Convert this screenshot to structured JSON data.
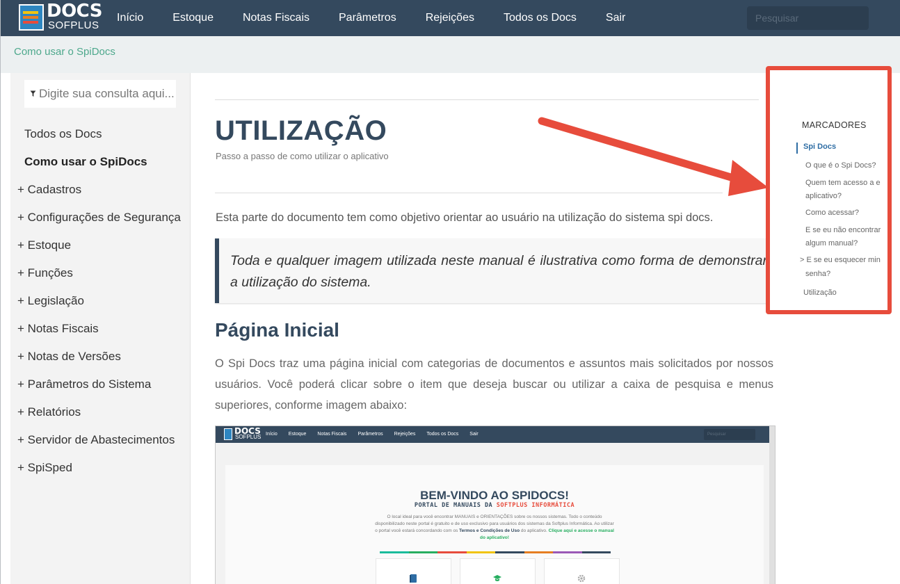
{
  "navbar": {
    "logo_text": "DOCS",
    "logo_sub": "SOFPLUS",
    "items": [
      "Início",
      "Estoque",
      "Notas Fiscais",
      "Parâmetros",
      "Rejeições",
      "Todos os Docs",
      "Sair"
    ],
    "search_placeholder": "Pesquisar"
  },
  "breadcrumb": "Como usar o SpiDocs",
  "sidebar": {
    "search_placeholder": "Digite sua consulta aqui...",
    "items": [
      {
        "label": "Todos os Docs",
        "prefix": ""
      },
      {
        "label": "Como usar o SpiDocs",
        "prefix": "",
        "active": true
      },
      {
        "label": "+ Cadastros",
        "prefix": "+"
      },
      {
        "label": "+ Configurações de Segurança",
        "prefix": "+"
      },
      {
        "label": "+ Estoque",
        "prefix": "+"
      },
      {
        "label": "+ Funções",
        "prefix": "+"
      },
      {
        "label": "+ Legislação",
        "prefix": "+"
      },
      {
        "label": "+ Notas Fiscais",
        "prefix": "+"
      },
      {
        "label": "+ Notas de Versões",
        "prefix": "+"
      },
      {
        "label": "+ Parâmetros do Sistema",
        "prefix": "+"
      },
      {
        "label": "+ Relatórios",
        "prefix": "+"
      },
      {
        "label": "+ Servidor de Abastecimentos",
        "prefix": "+"
      },
      {
        "label": "+ SpiSped",
        "prefix": "+"
      }
    ]
  },
  "main": {
    "title": "UTILIZAÇÃO",
    "subtitle": "Passo a passo de como utilizar o aplicativo",
    "intro": "Esta parte do documento tem como objetivo orientar ao usuário na utilização do sistema spi docs.",
    "quote": "Toda e qualquer imagem utilizada neste manual é ilustrativa como forma de demonstrar a utilização do sistema.",
    "section_title": "Página Inicial",
    "section_text": "O Spi Docs traz uma página inicial com categorias de documentos e assuntos mais solicitados por nossos usuários. Você poderá clicar sobre o item que deseja buscar ou utilizar a caixa de pesquisa e menus superiores, conforme imagem abaixo:"
  },
  "screenshot": {
    "logo_text": "DOCS",
    "logo_sub": "SOFPLUS",
    "nav_items": [
      "Início",
      "Estoque",
      "Notas Fiscais",
      "Parâmetros",
      "Rejeições",
      "Todos os Docs",
      "Sair"
    ],
    "search_placeholder": "Pesquisar",
    "welcome": "BEM-VINDO AO SPIDOCS!",
    "portal_prefix": "PORTAL DE MANUAIS DA ",
    "portal_brand": "SOFTPLUS INFORMÁTICA",
    "desc_1": "O local ideal para você encontrar MANUAIS e ORIENTAÇÕES sobre os nossos sistemas. Todo o conteúdo disponibilizado neste portal é gratuito e de uso exclusivo para usuários dos sistemas da Softplus Informática. Ao utilizar o portal você estará concordando com os ",
    "desc_terms": "Termos e Condições de Uso",
    "desc_2": " do aplicativo. ",
    "desc_link": "Clique aqui e acesse o manual do aplicativo!",
    "stripe_colors": [
      "#1abc9c",
      "#27ae60",
      "#e74c3c",
      "#f1c40f",
      "#34495e",
      "#e67e22",
      "#9b59b6",
      "#34495e"
    ]
  },
  "markers": {
    "title": "MARCADORES",
    "items": [
      {
        "label": "Spi Docs",
        "active": true
      },
      {
        "label": "O que é o Spi Docs?"
      },
      {
        "label": "Quem tem acesso a e"
      },
      {
        "label": "aplicativo?"
      },
      {
        "label": "Como acessar?"
      },
      {
        "label": "E se eu não encontrar"
      },
      {
        "label": "algum manual?"
      },
      {
        "label": "> E se eu esquecer min"
      },
      {
        "label": "senha?"
      },
      {
        "label": "Utilização"
      }
    ]
  },
  "colors": {
    "navbar": "#34495e",
    "accent_red": "#e74c3c",
    "breadcrumb": "#4da88c",
    "marker_active": "#2e6da4"
  }
}
